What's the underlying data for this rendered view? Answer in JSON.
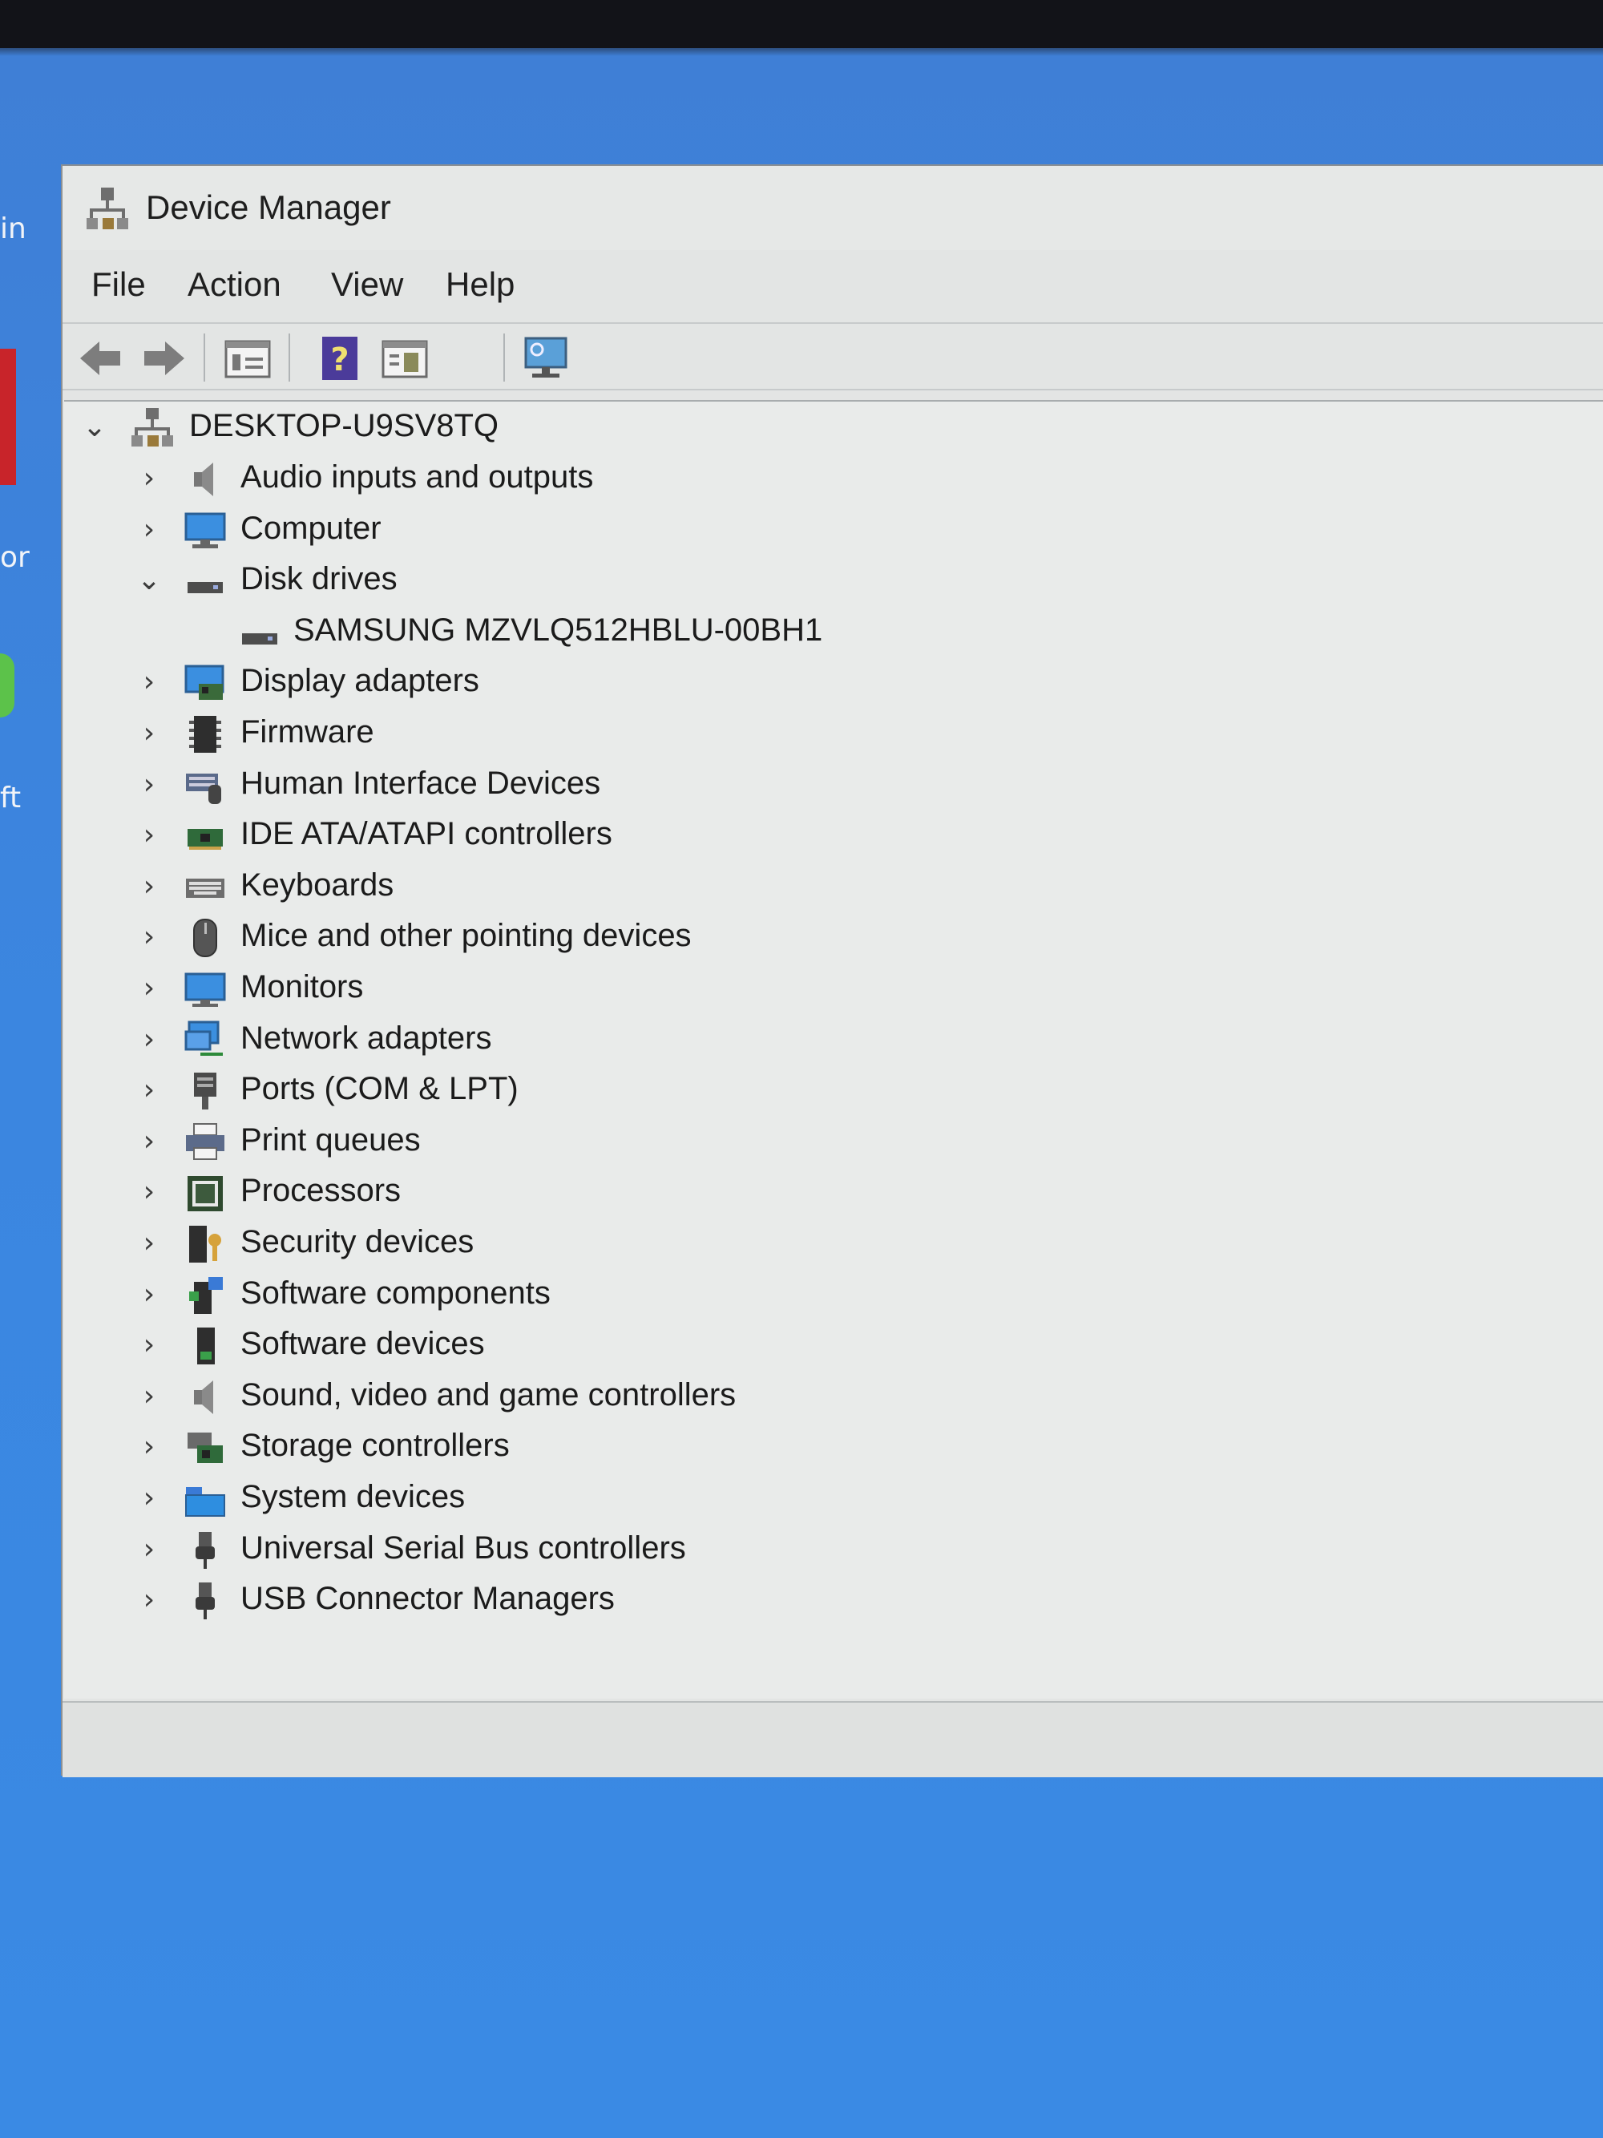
{
  "window": {
    "title": "Device Manager"
  },
  "desktop_edge": {
    "label_1": "in",
    "label_2": "or",
    "label_3": "ft"
  },
  "menu": {
    "items": [
      "File",
      "Action",
      "View",
      "Help"
    ]
  },
  "toolbar": {
    "buttons": [
      "back-icon",
      "forward-icon",
      "properties-icon",
      "help-icon",
      "update-driver-icon",
      "monitor-scan-icon"
    ]
  },
  "tree": {
    "root": {
      "label": "DESKTOP-U9SV8TQ",
      "expanded": true
    },
    "categories": [
      {
        "label": "Audio inputs and outputs",
        "icon": "speaker-icon",
        "expanded": false
      },
      {
        "label": "Computer",
        "icon": "computer-icon",
        "expanded": false
      },
      {
        "label": "Disk drives",
        "icon": "disk-drive-icon",
        "expanded": true,
        "children": [
          {
            "label": "SAMSUNG MZVLQ512HBLU-00BH1",
            "icon": "disk-drive-icon"
          }
        ]
      },
      {
        "label": "Display adapters",
        "icon": "display-adapter-icon",
        "expanded": false
      },
      {
        "label": "Firmware",
        "icon": "firmware-icon",
        "expanded": false
      },
      {
        "label": "Human Interface Devices",
        "icon": "hid-icon",
        "expanded": false
      },
      {
        "label": "IDE ATA/ATAPI controllers",
        "icon": "ide-controller-icon",
        "expanded": false
      },
      {
        "label": "Keyboards",
        "icon": "keyboard-icon",
        "expanded": false
      },
      {
        "label": "Mice and other pointing devices",
        "icon": "mouse-icon",
        "expanded": false
      },
      {
        "label": "Monitors",
        "icon": "monitor-icon",
        "expanded": false
      },
      {
        "label": "Network adapters",
        "icon": "network-adapter-icon",
        "expanded": false
      },
      {
        "label": "Ports (COM & LPT)",
        "icon": "port-icon",
        "expanded": false
      },
      {
        "label": "Print queues",
        "icon": "printer-icon",
        "expanded": false
      },
      {
        "label": "Processors",
        "icon": "processor-icon",
        "expanded": false
      },
      {
        "label": "Security devices",
        "icon": "security-device-icon",
        "expanded": false
      },
      {
        "label": "Software components",
        "icon": "software-component-icon",
        "expanded": false
      },
      {
        "label": "Software devices",
        "icon": "software-device-icon",
        "expanded": false
      },
      {
        "label": "Sound, video and game controllers",
        "icon": "speaker-icon",
        "expanded": false
      },
      {
        "label": "Storage controllers",
        "icon": "storage-controller-icon",
        "expanded": false
      },
      {
        "label": "System devices",
        "icon": "system-device-icon",
        "expanded": false
      },
      {
        "label": "Universal Serial Bus controllers",
        "icon": "usb-icon",
        "expanded": false
      },
      {
        "label": "USB Connector Managers",
        "icon": "usb-icon",
        "expanded": false
      }
    ]
  }
}
